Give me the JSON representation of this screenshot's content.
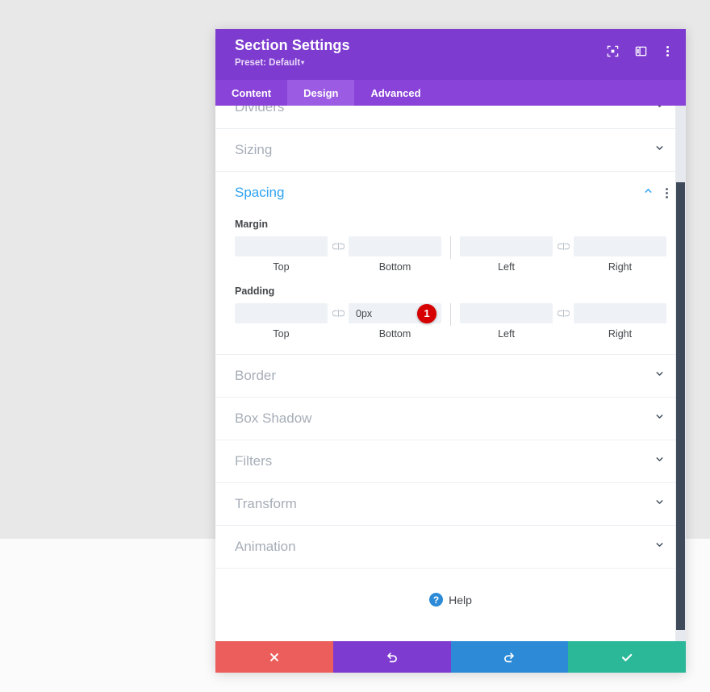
{
  "modal": {
    "title": "Section Settings",
    "preset_label": "Preset: Default",
    "preset_caret": "▾",
    "header_icons": [
      {
        "name": "fullscreen-icon",
        "label": "fullscreen"
      },
      {
        "name": "layout-view-icon",
        "label": "layout view"
      },
      {
        "name": "more-options-icon",
        "label": "more options"
      }
    ],
    "tabs": [
      {
        "label": "Content",
        "active": false
      },
      {
        "label": "Design",
        "active": true
      },
      {
        "label": "Advanced",
        "active": false
      }
    ]
  },
  "sections": {
    "above": [
      {
        "label": "Dividers"
      },
      {
        "label": "Sizing"
      }
    ],
    "open": {
      "label": "Spacing",
      "groups": [
        {
          "label": "Margin",
          "fields": [
            {
              "caption": "Top",
              "value": "",
              "placeholder": ""
            },
            {
              "caption": "Bottom",
              "value": "",
              "placeholder": ""
            },
            {
              "caption": "Left",
              "value": "",
              "placeholder": ""
            },
            {
              "caption": "Right",
              "value": "",
              "placeholder": ""
            }
          ]
        },
        {
          "label": "Padding",
          "fields": [
            {
              "caption": "Top",
              "value": "",
              "placeholder": ""
            },
            {
              "caption": "Bottom",
              "value": "0px",
              "placeholder": "",
              "badge": "1"
            },
            {
              "caption": "Left",
              "value": "",
              "placeholder": ""
            },
            {
              "caption": "Right",
              "value": "",
              "placeholder": ""
            }
          ]
        }
      ]
    },
    "below": [
      {
        "label": "Border"
      },
      {
        "label": "Box Shadow"
      },
      {
        "label": "Filters"
      },
      {
        "label": "Transform"
      },
      {
        "label": "Animation"
      }
    ]
  },
  "help": {
    "label": "Help",
    "icon_glyph": "?"
  },
  "footer": {
    "buttons": [
      {
        "name": "cancel-button",
        "icon": "close-icon"
      },
      {
        "name": "undo-button",
        "icon": "undo-icon"
      },
      {
        "name": "redo-button",
        "icon": "redo-icon"
      },
      {
        "name": "save-button",
        "icon": "check-icon"
      }
    ]
  },
  "colors": {
    "header_purple": "#7e3bd0",
    "tabbar_purple": "#8943d8",
    "tab_active_purple": "#9b5be3",
    "accent_blue": "#2ea3f2",
    "badge_red": "#d60000",
    "cancel_red": "#eb5e5b",
    "redo_blue": "#2c8ad6",
    "save_green": "#2bb899",
    "scrollbar_thumb": "#3e4a5a"
  }
}
